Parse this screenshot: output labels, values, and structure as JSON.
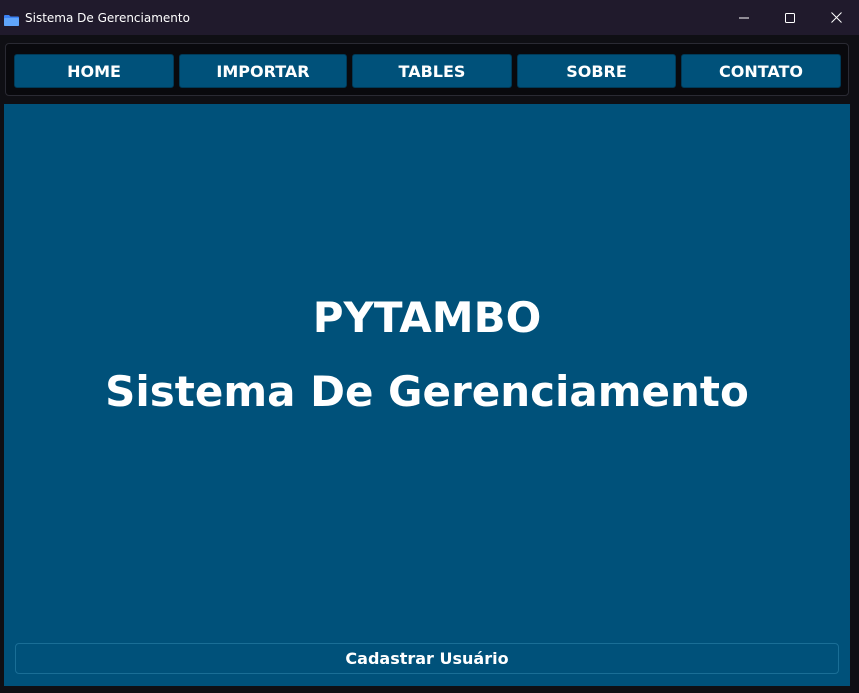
{
  "window": {
    "title": "Sistema De Gerenciamento",
    "app_icon": "folder-icon",
    "controls": [
      "minimize-icon",
      "maximize-icon",
      "close-icon"
    ]
  },
  "nav": {
    "items": [
      {
        "label": "HOME"
      },
      {
        "label": "IMPORTAR"
      },
      {
        "label": "TABLES"
      },
      {
        "label": "SOBRE"
      },
      {
        "label": "CONTATO"
      }
    ]
  },
  "main": {
    "brand": "PYTAMBO",
    "subtitle": "Sistema De Gerenciamento",
    "register_button": "Cadastrar Usuário"
  },
  "colors": {
    "titlebar": "#201a2c",
    "panel": "#00517a",
    "button": "#00517a",
    "text": "#ffffff"
  }
}
